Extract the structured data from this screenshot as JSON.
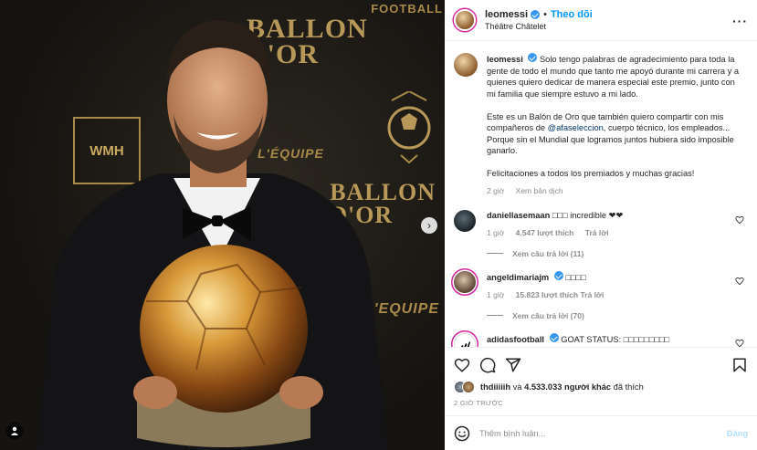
{
  "post": {
    "username": "leomessi",
    "follow_label": "Theo dõi",
    "separator": "•",
    "location": "Théâtre Châtelet",
    "more_label": "···"
  },
  "media": {
    "sponsors": {
      "football": "FOOTBALL",
      "ballon_top_1": "BALLON",
      "ballon_top_2": "D'OR",
      "ballon_right_1": "BALLON",
      "ballon_right_2": "D'OR",
      "lequipe_top": "L'ÉQUIPE",
      "lequipe_bottom": "L'EQUIPE",
      "wmh": "WMH"
    },
    "next_icon": "chevron-right-icon",
    "user_tag_icon": "user-icon"
  },
  "caption": {
    "username": "leomessi",
    "paragraph1": "Solo tengo palabras de agradecimiento para toda la gente de todo el mundo que tanto me apoyó durante mi carrera y a quienes quiero dedicar de manera especial este premio, junto con mi familia que siempre estuvo a mi lado.",
    "paragraph2_before": "Este es un Balón de Oro que también quiero compartir con mis compañeros de ",
    "paragraph2_mention": "@afaseleccion",
    "paragraph2_after": ", cuerpo técnico, los empleados... Porque sin el Mundial que logramos juntos hubiera sido imposible ganarlo.",
    "paragraph3": "Felicitaciones a todos los premiados y muchas gracias!",
    "time": "2 giờ",
    "translate": "Xem bản dịch"
  },
  "comments": [
    {
      "username": "daniellasemaan",
      "text": "□□□ incredible ❤❤",
      "time": "1 giờ",
      "likes": "4.547 lượt thích",
      "reply": "Trả lời",
      "view_replies": "Xem câu trả lời (11)"
    },
    {
      "username": "angeldimariajm",
      "text": "□□□□",
      "time": "1 giờ",
      "likes": "15.823 lượt thích",
      "reply": "Trả lời",
      "view_replies": "Xem câu trả lời (70)"
    },
    {
      "username": "adidasfootball",
      "text": "GOAT STATUS: □□□□□□□□□"
    }
  ],
  "actions": {
    "liked_by_user": "thdiiiiih",
    "liked_conj": "và",
    "others_count": "4.533.033 người khác",
    "liked_suffix": "đã thích",
    "time_ago": "2 GIỜ TRƯỚC"
  },
  "composer": {
    "placeholder": "Thêm bình luận...",
    "post_label": "Đăng"
  }
}
